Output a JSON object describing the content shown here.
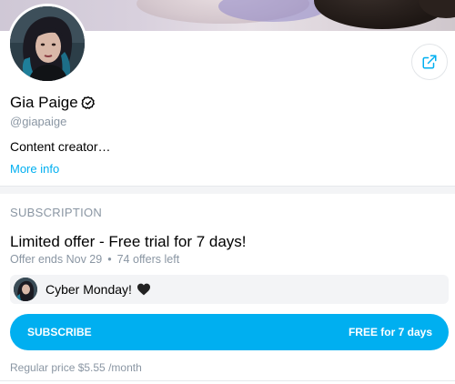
{
  "profile": {
    "name": "Gia Paige",
    "handle": "@giapaige",
    "bio": "Content creator…",
    "more_info_label": "More info",
    "verified_icon": "verified-badge-icon",
    "share_icon": "share-icon"
  },
  "subscription": {
    "header": "SUBSCRIPTION",
    "offer_title": "Limited offer - Free trial for 7 days!",
    "offer_ends": "Offer ends Nov 29",
    "separator": "•",
    "offers_left": "74 offers left",
    "promo_message": "Cyber Monday!",
    "promo_icon": "black-heart-icon",
    "subscribe_label": "SUBSCRIBE",
    "subscribe_price": "FREE for 7 days",
    "regular_price": "Regular price $5.55 /month"
  },
  "colors": {
    "accent": "#00aff0",
    "muted_text": "#8a96a3",
    "promo_bg": "#f3f4f6"
  }
}
